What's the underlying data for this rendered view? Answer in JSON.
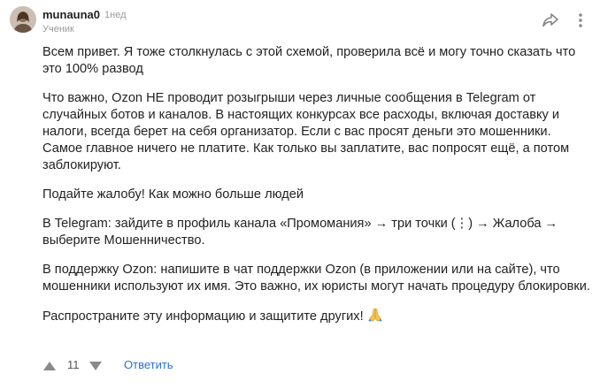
{
  "comment": {
    "author": {
      "name": "munauna0",
      "time": "1нед",
      "role": "Ученик",
      "avatar_icon": "user-avatar-icon"
    },
    "actions": {
      "share_icon": "share-icon",
      "more_icon": "more-vertical-icon"
    },
    "paragraphs": [
      "Всем привет. Я тоже столкнулась с этой схемой, проверила всё и могу точно сказать что это 100% развод",
      "Что важно, Ozon НЕ проводит розыгрыши через личные сообщения в Telegram от случайных ботов и каналов. В настоящих конкурсах все расходы, включая доставку и налоги, всегда берет на себя организатор. Если с вас просят деньги это мошенники. Самое главное ничего не платите. Как только вы заплатите, вас попросят ещё, а потом заблокируют.",
      "Подайте жалобу! Как можно больше людей",
      "В Telegram: зайдите в профиль канала «Промомания» → три точки (⋮) → Жалоба → выберите Мошенничество.",
      "В поддержку Ozon: напишите в чат поддержки Ozon (в приложении или на сайте), что мошенники используют их имя. Это важно, их юристы могут начать процедуру блокировки.",
      "Распространите эту информацию и защитите других!"
    ],
    "emoji_icon": "folded-hands-icon",
    "footer": {
      "votes": "11",
      "reply_label": "Ответить",
      "upvote_icon": "triangle-up-icon",
      "downvote_icon": "triangle-down-icon"
    }
  },
  "colors": {
    "link": "#2a6fdb",
    "muted": "#9a9a9a",
    "text": "#222222",
    "vote_arrow": "#8a8a8a"
  }
}
